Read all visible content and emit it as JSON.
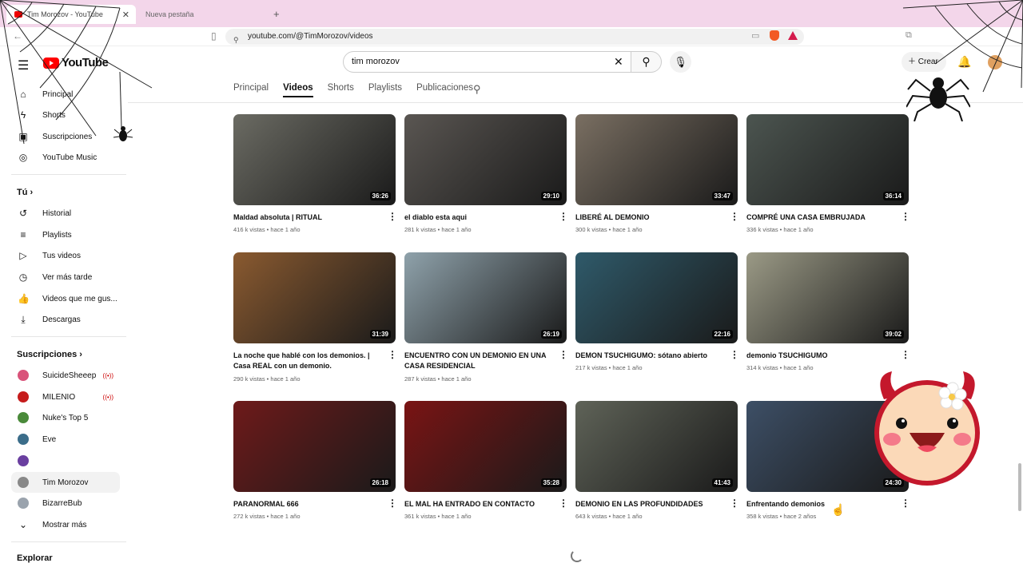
{
  "browser": {
    "active_tab": "Tim Morozov - YouTube",
    "inactive_tab": "Nueva pestaña",
    "new_tab_icon": "plus-icon",
    "url": "youtube.com/@TimMorozov/videos"
  },
  "header": {
    "logo": "YouTube",
    "search_value": "tim morozov",
    "create_label": "Crear"
  },
  "sidebar": {
    "main": [
      {
        "label": "Principal",
        "icon": "home-icon"
      },
      {
        "label": "Shorts",
        "icon": "shorts-icon"
      },
      {
        "label": "Suscripciones",
        "icon": "subscriptions-icon"
      },
      {
        "label": "YouTube Music",
        "icon": "music-icon"
      }
    ],
    "you_heading": "Tú",
    "you": [
      {
        "label": "Historial",
        "icon": "history-icon"
      },
      {
        "label": "Playlists",
        "icon": "playlists-icon"
      },
      {
        "label": "Tus videos",
        "icon": "your-videos-icon"
      },
      {
        "label": "Ver más tarde",
        "icon": "watch-later-icon"
      },
      {
        "label": "Videos que me gus...",
        "icon": "liked-icon"
      },
      {
        "label": "Descargas",
        "icon": "download-icon"
      }
    ],
    "subs_heading": "Suscripciones",
    "subs": [
      {
        "label": "SuicideSheeep",
        "live": true,
        "color": "#d9537a"
      },
      {
        "label": "MILENIO",
        "live": true,
        "color": "#c61c1c"
      },
      {
        "label": "Nuke's Top 5",
        "live": false,
        "color": "#4a8a3a"
      },
      {
        "label": "Eve",
        "live": false,
        "color": "#3b6d8a"
      },
      {
        "label": "",
        "live": false,
        "color": "#6a3fa0"
      },
      {
        "label": "Tim Morozov",
        "live": false,
        "color": "#888888"
      },
      {
        "label": "BizarreBub",
        "live": false,
        "color": "#9aa3ad"
      }
    ],
    "show_more": "Mostrar más",
    "explore_heading": "Explorar"
  },
  "channel_tabs": [
    "Principal",
    "Videos",
    "Shorts",
    "Playlists",
    "Publicaciones"
  ],
  "active_channel_tab": "Videos",
  "videos": [
    {
      "title": "Maldad absoluta | RITUAL",
      "meta": "416 k vistas • hace 1 año",
      "duration": "36:26",
      "bg": "#6b6b63"
    },
    {
      "title": "el diablo esta aqui",
      "meta": "281 k vistas • hace 1 año",
      "duration": "29:10",
      "bg": "#5a5652"
    },
    {
      "title": "LIBERÉ AL DEMONIO",
      "meta": "300 k vistas • hace 1 año",
      "duration": "33:47",
      "bg": "#7a6f62"
    },
    {
      "title": "COMPRÉ UNA CASA EMBRUJADA",
      "meta": "336 k vistas • hace 1 año",
      "duration": "36:14",
      "bg": "#4c5550"
    },
    {
      "title": "La noche que hablé con los demonios. | Casa REAL con un demonio.",
      "meta": "290 k vistas • hace 1 año",
      "duration": "31:39",
      "bg": "#8a5a30"
    },
    {
      "title": "ENCUENTRO CON UN DEMONIO EN UNA CASA RESIDENCIAL",
      "meta": "287 k vistas • hace 1 año",
      "duration": "26:19",
      "bg": "#8fa2ab"
    },
    {
      "title": "DEMON TSUCHIGUMO: sótano abierto",
      "meta": "217 k vistas • hace 1 año",
      "duration": "22:16",
      "bg": "#2f5a6a"
    },
    {
      "title": "demonio TSUCHIGUMO",
      "meta": "314 k vistas • hace 1 año",
      "duration": "39:02",
      "bg": "#9b9a86"
    },
    {
      "title": "PARANORMAL 666",
      "meta": "272 k vistas • hace 1 año",
      "duration": "26:18",
      "bg": "#6e1a1a"
    },
    {
      "title": "EL MAL HA ENTRADO EN CONTACTO",
      "meta": "361 k vistas • hace 1 año",
      "duration": "35:28",
      "bg": "#7a1414"
    },
    {
      "title": "DEMONIO EN LAS PROFUNDIDADES",
      "meta": "643 k vistas • hace 1 año",
      "duration": "41:43",
      "bg": "#5f6358"
    },
    {
      "title": "Enfrentando demonios",
      "meta": "358 k vistas • hace 2 años",
      "duration": "24:30",
      "bg": "#3d4f66"
    }
  ]
}
